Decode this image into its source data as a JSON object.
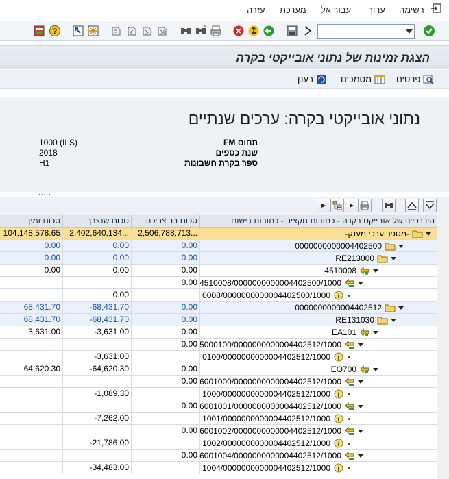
{
  "menubar": {
    "items": [
      "רשימה",
      "ערוך",
      "עבור אל",
      "מערכת",
      "עזרה"
    ]
  },
  "toolbar": {
    "command_field_value": ""
  },
  "title": "הצגת זמינות של נתוני אובייקטי בקרה",
  "app_toolbar": {
    "details": "פרטים",
    "documents": "מסמכים",
    "refresh": "רענן"
  },
  "header": {
    "heading": "נתוני אובייקטי בקרה: ערכים שנתיים",
    "fields": [
      {
        "label": "תחום FM",
        "value": "1000 (ILS)"
      },
      {
        "label": "שנת כספים",
        "value": "2018"
      },
      {
        "label": "ספר בקרת חשבונות",
        "value": "H1"
      }
    ],
    "sash": "....."
  },
  "grid": {
    "columns": {
      "hierarchy": "היררכייה של אובייקט בקרה - כתובות תקציב - כתובות רישום",
      "consumable": "סכום בר צריכה",
      "consumed": "סכום שנצרך",
      "available": "סכום זמין"
    },
    "summary": {
      "label": "-מספר ערכי מענק-",
      "consumable": "2,506,788,713...",
      "consumed": "2,402,640,134...",
      "available": "104,148,578.65"
    },
    "rows": [
      {
        "text": "0000000000004402500",
        "consumable": "0.00",
        "consumed": "0.00",
        "available": "0.00",
        "style": "blue"
      },
      {
        "text": "RE213000",
        "consumable": "0.00",
        "consumed": "0.00",
        "available": "0.00",
        "style": "blue"
      },
      {
        "text": "4510008",
        "consumable": "0.00",
        "consumed": "0.00",
        "available": "0.00",
        "style": "plain"
      },
      {
        "text": "4510008/0000000000004402500/1000",
        "consumable": "0.00",
        "consumed": "",
        "available": "",
        "style": "plain"
      },
      {
        "text": "0008/0000000000004402500/1000",
        "consumable": "",
        "consumed": "0.00",
        "available": "",
        "style": "plain"
      },
      {
        "text": "0000000000004402512",
        "consumable": "0.00",
        "consumed": "-68,431.70",
        "available": "68,431.70",
        "style": "blue"
      },
      {
        "text": "RE131030",
        "consumable": "0.00",
        "consumed": "-68,431.70",
        "available": "68,431.70",
        "style": "blue"
      },
      {
        "text": "EA101",
        "consumable": "0.00",
        "consumed": "-3,631.00",
        "available": "3,631.00",
        "style": "plain"
      },
      {
        "text": "5000100/0000000000004402512/1000",
        "consumable": "0.00",
        "consumed": "",
        "available": "",
        "style": "plain"
      },
      {
        "text": "0100/0000000000004402512/1000",
        "consumable": "",
        "consumed": "-3,631.00",
        "available": "",
        "style": "plain"
      },
      {
        "text": "EO700",
        "consumable": "0.00",
        "consumed": "-64,620.30",
        "available": "64,620.30",
        "style": "plain"
      },
      {
        "text": "6001000/0000000000004402512/1000",
        "consumable": "0.00",
        "consumed": "",
        "available": "",
        "style": "plain"
      },
      {
        "text": "1000/0000000000004402512/1000",
        "consumable": "",
        "consumed": "-1,089.30",
        "available": "",
        "style": "plain"
      },
      {
        "text": "6001001/0000000000004402512/1000",
        "consumable": "0.00",
        "consumed": "",
        "available": "",
        "style": "plain"
      },
      {
        "text": "1001/0000000000004402512/1000",
        "consumable": "",
        "consumed": "-7,262.00",
        "available": "",
        "style": "plain"
      },
      {
        "text": "6001002/0000000000004402512/1000",
        "consumable": "0.00",
        "consumed": "",
        "available": "",
        "style": "plain"
      },
      {
        "text": "1002/0000000000004402512/1000",
        "consumable": "",
        "consumed": "-21,786.00",
        "available": "",
        "style": "plain"
      },
      {
        "text": "6001004/0000000000004402512/1000",
        "consumable": "0.00",
        "consumed": "",
        "available": "",
        "style": "plain"
      },
      {
        "text": "1004/0000000000004402512/1000",
        "consumable": "",
        "consumed": "-34,483.00",
        "available": "",
        "style": "plain"
      }
    ]
  },
  "colors": {
    "summary_row": "#fddf94",
    "header_row": "#dfe6ee",
    "blue_value": "#1a54a8",
    "title_bar": "#dde5ec"
  }
}
